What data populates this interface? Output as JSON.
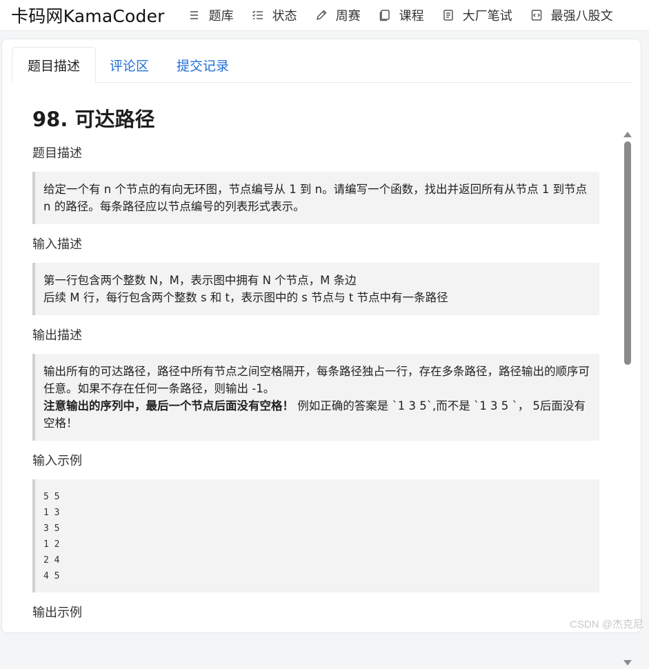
{
  "header": {
    "logo": "卡码网KamaCoder",
    "nav": [
      {
        "label": "题库",
        "icon": "list-icon"
      },
      {
        "label": "状态",
        "icon": "checklist-icon"
      },
      {
        "label": "周赛",
        "icon": "pencil-icon"
      },
      {
        "label": "课程",
        "icon": "book-icon"
      },
      {
        "label": "大厂笔试",
        "icon": "document-icon"
      },
      {
        "label": "最强八股文",
        "icon": "code-file-icon"
      }
    ]
  },
  "tabs": [
    "题目描述",
    "评论区",
    "提交记录"
  ],
  "problem": {
    "title": "98. 可达路径",
    "desc_heading": "题目描述",
    "desc_text": "给定一个有 n 个节点的有向无环图，节点编号从 1 到 n。请编写一个函数，找出并返回所有从节点 1 到节点 n 的路径。每条路径应以节点编号的列表形式表示。",
    "input_heading": "输入描述",
    "input_line1": "第一行包含两个整数 N，M，表示图中拥有 N 个节点，M 条边",
    "input_line2": "后续 M 行，每行包含两个整数 s 和 t，表示图中的 s 节点与 t 节点中有一条路径",
    "output_heading": "输出描述",
    "output_text": "输出所有的可达路径，路径中所有节点之间空格隔开，每条路径独占一行，存在多条路径，路径输出的顺序可任意。如果不存在任何一条路径，则输出 -1。",
    "output_bold": "注意输出的序列中，最后一个节点后面没有空格！",
    "output_tail": " 例如正确的答案是 `1 3 5`,而不是 `1 3 5 `， 5后面没有空格！",
    "sample_in_heading": "输入示例",
    "sample_in_lines": [
      "5 5",
      "1 3",
      "3 5",
      "1 2",
      "2 4",
      "4 5"
    ],
    "sample_out_heading": "输出示例"
  },
  "watermark": "CSDN @杰克尼"
}
